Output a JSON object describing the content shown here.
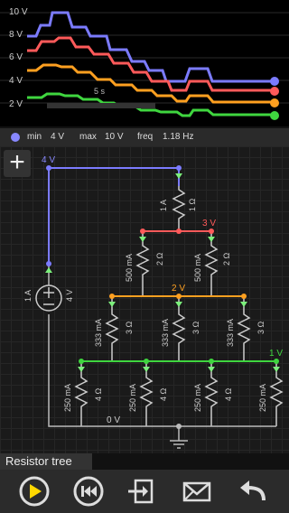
{
  "scope": {
    "y_labels": [
      "10 V",
      "8 V",
      "6 V",
      "4 V",
      "2 V"
    ],
    "time_label": "5 s",
    "trace_colors": [
      "#7b7bff",
      "#ff5a5a",
      "#ff9c1a",
      "#3fd63f"
    ]
  },
  "info": {
    "dot_color": "#8888ff",
    "min_label": "min",
    "min_value": "4 V",
    "max_label": "max",
    "max_value": "10 V",
    "freq_label": "freq",
    "freq_value": "1.18 Hz"
  },
  "add_button": "+",
  "circuit": {
    "node_labels": [
      "4 V",
      "3 V",
      "2 V",
      "1 V",
      "0 V"
    ],
    "source_current": "1 A",
    "source_voltage": "4 V",
    "r1_current": "1 A",
    "r1_value": "1 Ω",
    "r2a_current": "500 mA",
    "r2a_value": "2 Ω",
    "r2b_current": "500 mA",
    "r2b_value": "2 Ω",
    "r3_current": "333 mA",
    "r3_value": "3 Ω",
    "r4_current": "250 mA",
    "r4_value": "4 Ω"
  },
  "circuit_name": "Resistor tree",
  "toolbar": {
    "icons": [
      "play-icon",
      "rewind-icon",
      "import-icon",
      "mail-icon",
      "undo-icon"
    ]
  }
}
